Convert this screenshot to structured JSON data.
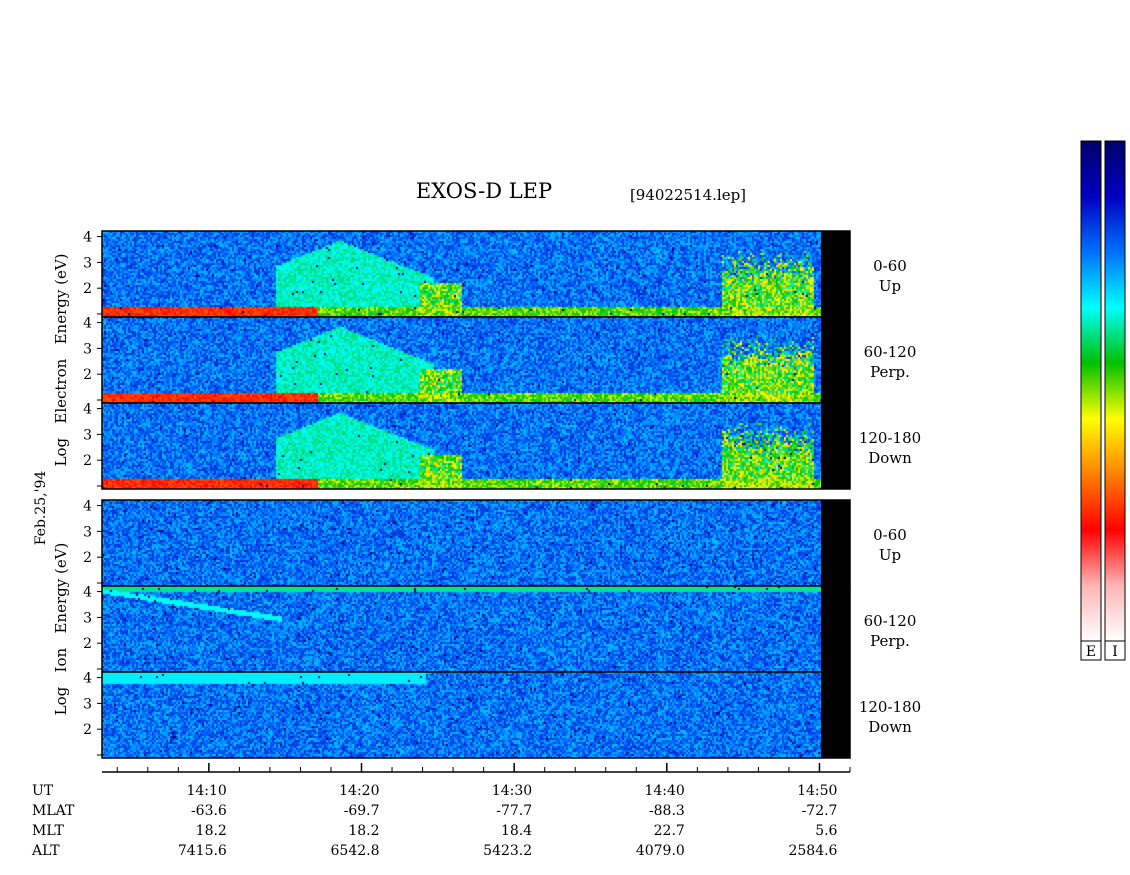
{
  "chart_data": {
    "type": "heatmap",
    "title": "EXOS-D LEP",
    "file_label": "[94022514.lep]",
    "date_label": "Feb.25,'94",
    "y_ticks": [
      "1",
      "2",
      "3",
      "4"
    ],
    "ylim": [
      1,
      4.1
    ],
    "y_scale": "log10 energy (eV)",
    "groups": [
      {
        "id": "electron",
        "ylabel": "Log   Electron   Energy (eV)",
        "colorbar_label": "E",
        "panels": [
          {
            "range": "0-60",
            "direction": "Up"
          },
          {
            "range": "60-120",
            "direction": "Perp."
          },
          {
            "range": "120-180",
            "direction": "Down"
          }
        ]
      },
      {
        "id": "ion",
        "ylabel": "Log   Ion   Energy (eV)",
        "colorbar_label": "I",
        "panels": [
          {
            "range": "0-60",
            "direction": "Up"
          },
          {
            "range": "60-120",
            "direction": "Perp."
          },
          {
            "range": "120-180",
            "direction": "Down"
          }
        ]
      }
    ],
    "x_axis": {
      "start_minutes": 843,
      "end_minutes": 892,
      "data_end_minutes": 891,
      "minor_tick_minutes": 2,
      "major_ticks": [
        {
          "label": "14:10",
          "minutes": 850,
          "mlat": "-63.6",
          "mlt": "18.2",
          "alt": "7415.6"
        },
        {
          "label": "14:20",
          "minutes": 860,
          "mlat": "-69.7",
          "mlt": "18.2",
          "alt": "6542.8"
        },
        {
          "label": "14:30",
          "minutes": 870,
          "mlat": "-77.7",
          "mlt": "18.4",
          "alt": "5423.2"
        },
        {
          "label": "14:40",
          "minutes": 880,
          "mlat": "-88.3",
          "mlt": "22.7",
          "alt": "4079.0"
        },
        {
          "label": "14:50",
          "minutes": 890,
          "mlat": "-72.7",
          "mlt": "5.6",
          "alt": "2584.6"
        }
      ]
    },
    "row_labels": [
      "UT",
      "MLAT",
      "MLT",
      "ALT"
    ],
    "colorscale": [
      "#ffffff",
      "#ffb4b4",
      "#ff0000",
      "#ff8000",
      "#ffff00",
      "#00c000",
      "#00ffff",
      "#0070ff",
      "#0000c0",
      "#00006a"
    ]
  }
}
